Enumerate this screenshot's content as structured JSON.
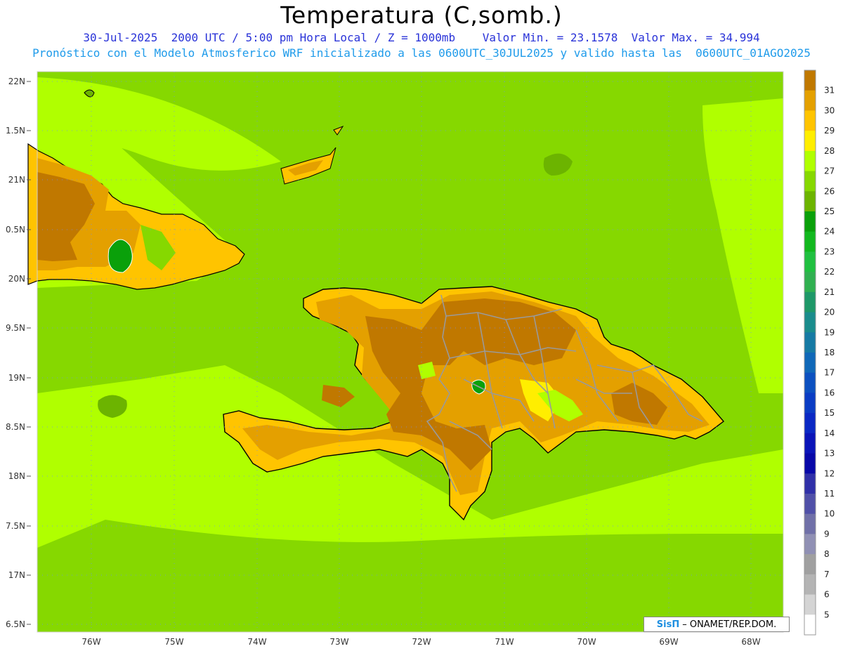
{
  "header": {
    "title": "Temperatura (C,somb.)",
    "line1": "30-Jul-2025  2000 UTC / 5:00 pm Hora Local / Z = 1000mb    Valor Min. = 23.1578  Valor Max. = 34.994",
    "line2": "Pronóstico con el Modelo Atmosferico WRF inicializado a las 0600UTC_30JUL2025 y valido hasta las  0600UTC_01AGO2025"
  },
  "map": {
    "lat_labels": [
      "22N",
      "1.5N",
      "21N",
      "0.5N",
      "20N",
      "9.5N",
      "19N",
      "8.5N",
      "18N",
      "7.5N",
      "17N",
      "6.5N"
    ],
    "lon_labels": [
      "76W",
      "75W",
      "74W",
      "73W",
      "72W",
      "71W",
      "70W",
      "69W",
      "68W"
    ],
    "valid_min": 23.1578,
    "valid_max": 34.994
  },
  "colorbar": {
    "labels": [
      "31",
      "30",
      "29",
      "28",
      "27",
      "26",
      "25",
      "24",
      "23",
      "22",
      "21",
      "20",
      "19",
      "18",
      "17",
      "16",
      "15",
      "14",
      "13",
      "12",
      "11",
      "10",
      "9",
      "8",
      "7",
      "6",
      "5"
    ],
    "colors": [
      "#c07800",
      "#e4a000",
      "#ffc400",
      "#ffee00",
      "#b0ff00",
      "#86d800",
      "#6cb400",
      "#0aa00a",
      "#12b81e",
      "#20c040",
      "#30b050",
      "#1e9868",
      "#1a8c8c",
      "#167aa4",
      "#1068b8",
      "#0c50c0",
      "#0a3cc4",
      "#0a28c4",
      "#0a14b8",
      "#0808a8",
      "#3030a8",
      "#5050a8",
      "#7070a8",
      "#9090b4",
      "#a0a0a0",
      "#b4b4b4",
      "#d4d4d4",
      "#ffffff"
    ]
  },
  "credit": {
    "brand": "SisΠ",
    "org": "– ONAMET/REP.DOM."
  }
}
